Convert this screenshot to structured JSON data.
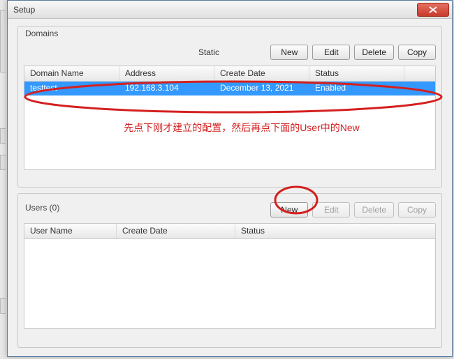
{
  "window": {
    "title": "Setup"
  },
  "domains": {
    "group_label": "Domains",
    "type_label": "Static",
    "buttons": {
      "new": "New",
      "edit": "Edit",
      "delete": "Delete",
      "copy": "Copy"
    },
    "columns": {
      "name": "Domain Name",
      "address": "Address",
      "create_date": "Create Date",
      "status": "Status"
    },
    "rows": [
      {
        "name": "testtest",
        "address": "192.168.3.104",
        "create_date": "December 13, 2021",
        "status": "Enabled",
        "selected": true
      }
    ]
  },
  "users": {
    "group_label_prefix": "Users",
    "count": 0,
    "group_label": "Users (0)",
    "buttons": {
      "new": "New",
      "edit": "Edit",
      "delete": "Delete",
      "copy": "Copy"
    },
    "columns": {
      "name": "User Name",
      "create_date": "Create Date",
      "status": "Status"
    },
    "rows": []
  },
  "annotations": {
    "text": "先点下刚才建立的配置，然后再点下面的User中的New",
    "color": "#d42020"
  }
}
